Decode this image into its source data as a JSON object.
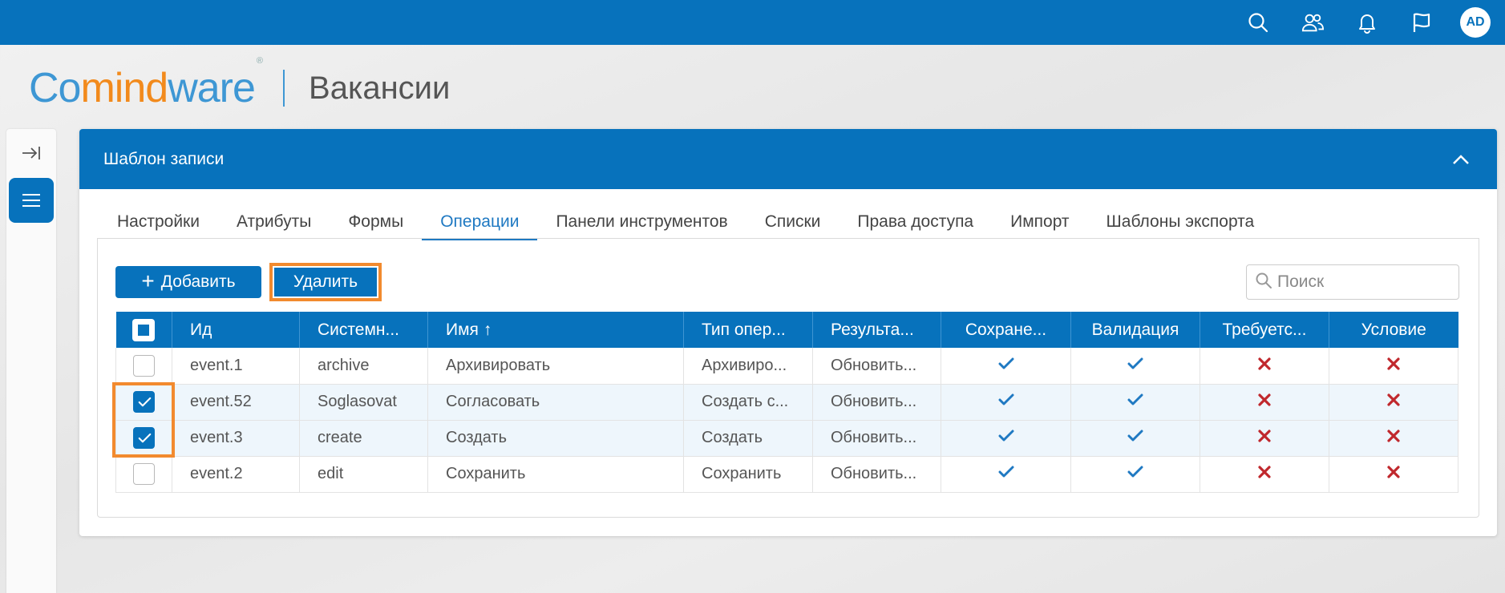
{
  "topbar": {
    "icons": [
      "search-icon",
      "users-icon",
      "bell-icon",
      "flag-icon"
    ],
    "avatar_initials": "AD",
    "color": "#0772bc"
  },
  "header": {
    "logo_part1": "Co",
    "logo_part2": "mind",
    "logo_part3": "ware",
    "logo_reg": "®",
    "page_title": "Вакансии"
  },
  "panel": {
    "title": "Шаблон записи",
    "tabs": [
      {
        "label": "Настройки",
        "active": false
      },
      {
        "label": "Атрибуты",
        "active": false
      },
      {
        "label": "Формы",
        "active": false
      },
      {
        "label": "Операции",
        "active": true
      },
      {
        "label": "Панели инструментов",
        "active": false
      },
      {
        "label": "Списки",
        "active": false
      },
      {
        "label": "Права доступа",
        "active": false
      },
      {
        "label": "Импорт",
        "active": false
      },
      {
        "label": "Шаблоны экспорта",
        "active": false
      }
    ]
  },
  "toolbar": {
    "add_label": "Добавить",
    "delete_label": "Удалить",
    "search_placeholder": "Поиск"
  },
  "table": {
    "columns": [
      "Ид",
      "Системн...",
      "Имя",
      "Тип опер...",
      "Результа...",
      "Сохране...",
      "Валидация",
      "Требуетс...",
      "Условие"
    ],
    "sort_indicator": "↑",
    "rows": [
      {
        "checked": false,
        "id": "event.1",
        "system": "archive",
        "name": "Архивировать",
        "type": "Архивиро...",
        "result": "Обновить...",
        "save": true,
        "validate": true,
        "required": false,
        "condition": false
      },
      {
        "checked": true,
        "id": "event.52",
        "system": "Soglasovat",
        "name": "Согласовать",
        "type": "Создать с...",
        "result": "Обновить...",
        "save": true,
        "validate": true,
        "required": false,
        "condition": false
      },
      {
        "checked": true,
        "id": "event.3",
        "system": "create",
        "name": "Создать",
        "type": "Создать",
        "result": "Обновить...",
        "save": true,
        "validate": true,
        "required": false,
        "condition": false
      },
      {
        "checked": false,
        "id": "event.2",
        "system": "edit",
        "name": "Сохранить",
        "type": "Сохранить",
        "result": "Обновить...",
        "save": true,
        "validate": true,
        "required": false,
        "condition": false
      }
    ]
  },
  "colors": {
    "primary": "#0772bc",
    "highlight": "#f28a2e",
    "check": "#1f79c2",
    "cross": "#c0282d"
  }
}
